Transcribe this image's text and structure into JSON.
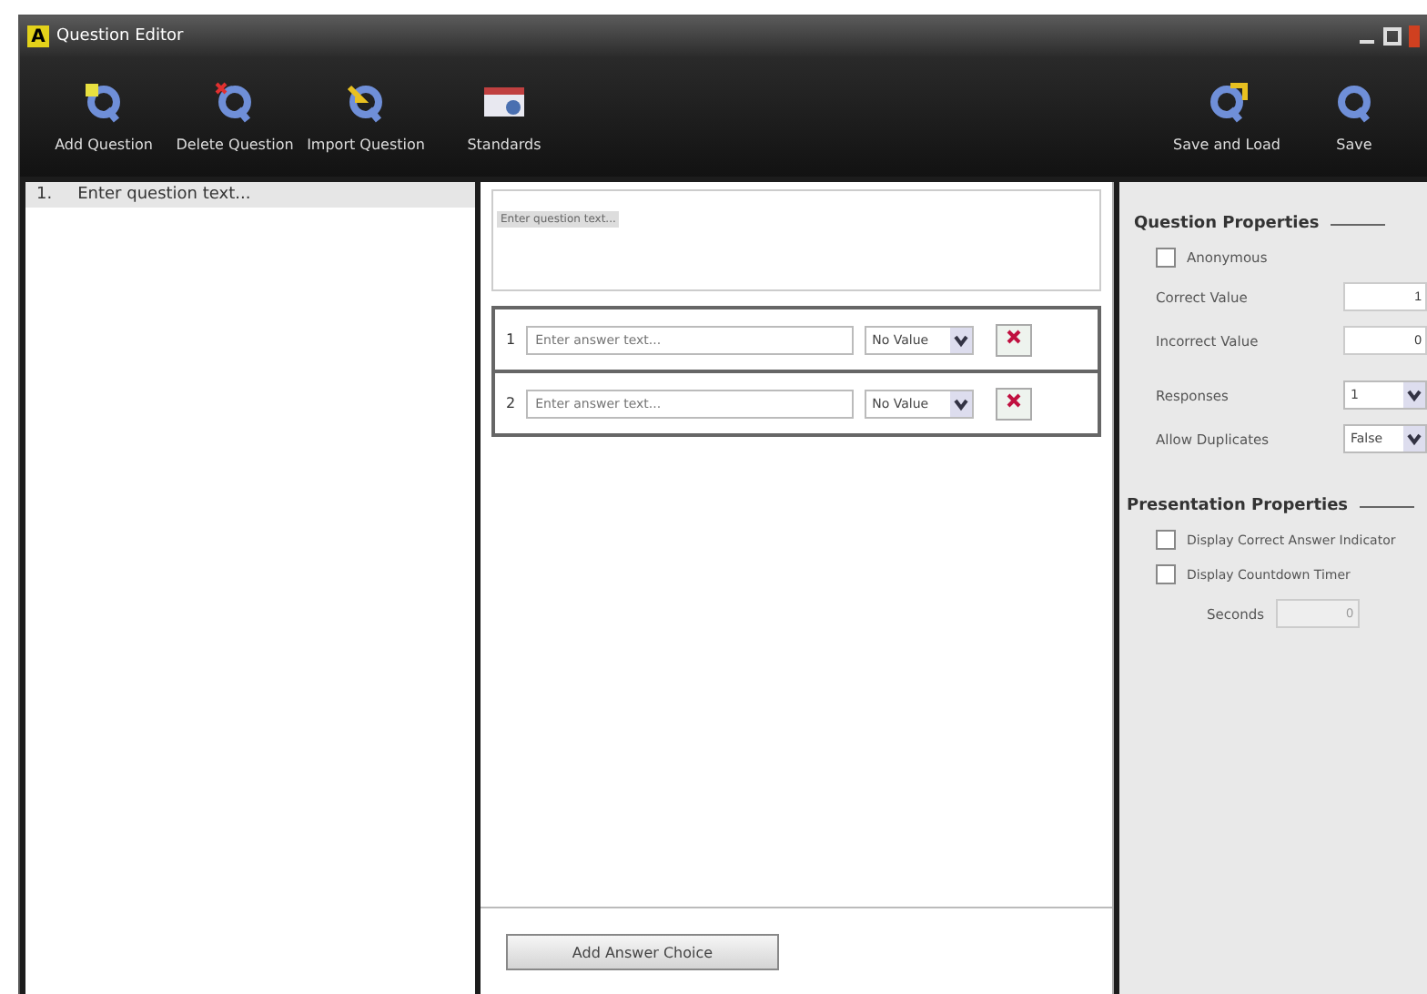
{
  "window": {
    "logo": "A",
    "title": "Question Editor"
  },
  "toolbar": {
    "left": [
      {
        "kind": "add",
        "label": "Add Question"
      },
      {
        "kind": "delete",
        "label": "Delete Question"
      },
      {
        "kind": "import",
        "label": "Import Question"
      },
      {
        "kind": "standards",
        "label": "Standards"
      }
    ],
    "right": [
      {
        "kind": "saveload",
        "label": "Save and Load"
      },
      {
        "kind": "save",
        "label": "Save"
      }
    ]
  },
  "questions": [
    {
      "number": "1.",
      "text": "Enter question text...",
      "selected": true
    }
  ],
  "editor": {
    "question_chip": "Enter question text...",
    "answers": [
      {
        "number": "1",
        "placeholder": "Enter answer text...",
        "value": "No Value"
      },
      {
        "number": "2",
        "placeholder": "Enter answer text...",
        "value": "No Value"
      }
    ],
    "add_button": "Add Answer Choice"
  },
  "question_properties": {
    "heading": "Question Properties",
    "anonymous": {
      "label": "Anonymous",
      "checked": false
    },
    "correct_value": {
      "label": "Correct Value",
      "value": "1"
    },
    "incorrect_value": {
      "label": "Incorrect Value",
      "value": "0"
    },
    "responses": {
      "label": "Responses",
      "value": "1"
    },
    "allow_duplicates": {
      "label": "Allow Duplicates",
      "value": "False"
    }
  },
  "presentation_properties": {
    "heading": "Presentation Properties",
    "options": [
      {
        "label": "Display Correct Answer Indicator",
        "checked": false
      },
      {
        "label": "Display Countdown Timer",
        "checked": false
      }
    ],
    "seconds": {
      "label": "Seconds",
      "value": "0",
      "disabled": true
    }
  }
}
